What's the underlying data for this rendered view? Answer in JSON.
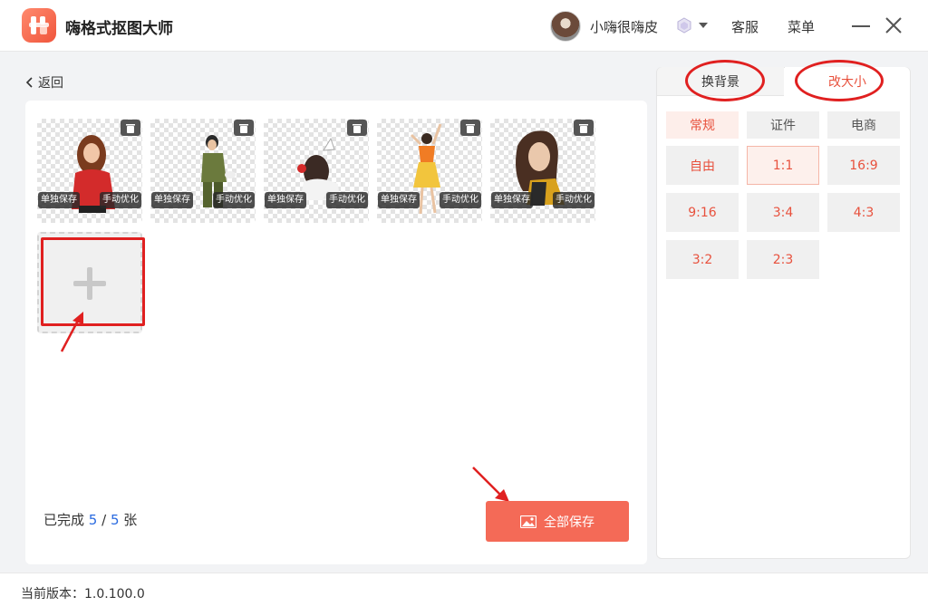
{
  "app": {
    "title": "嗨格式抠图大师",
    "username": "小嗨很嗨皮",
    "menu": [
      "客服",
      "菜单"
    ]
  },
  "nav": {
    "back_label": "返回"
  },
  "images": [
    {
      "save_label": "单独保存",
      "optimize_label": "手动优化",
      "subject": "woman-red-sweater"
    },
    {
      "save_label": "单独保存",
      "optimize_label": "手动优化",
      "subject": "woman-camo-outfit"
    },
    {
      "save_label": "单独保存",
      "optimize_label": "手动优化",
      "subject": "woman-seated-with-cup"
    },
    {
      "save_label": "单独保存",
      "optimize_label": "手动优化",
      "subject": "woman-jumping-yellow-skirt"
    },
    {
      "save_label": "单独保存",
      "optimize_label": "手动优化",
      "subject": "woman-portrait-dark-hair"
    }
  ],
  "progress": {
    "prefix": "已完成",
    "done": "5",
    "sep": "/",
    "total": "5",
    "suffix": "张"
  },
  "save_all_label": "全部保存",
  "panel": {
    "tabs": [
      "换背景",
      "改大小"
    ],
    "active_tab": "改大小",
    "categories": [
      "常规",
      "证件",
      "电商"
    ],
    "active_category": "常规",
    "ratios": [
      "自由",
      "1:1",
      "16:9",
      "9:16",
      "3:4",
      "4:3",
      "3:2",
      "2:3"
    ],
    "selected_ratio": "1:1"
  },
  "footer": {
    "version_label": "当前版本：1.0.100.0"
  },
  "colors": {
    "accent": "#f46a57",
    "accent_text": "#e8513d",
    "number_blue": "#2a6ae0",
    "annotation_red": "#e02020"
  }
}
